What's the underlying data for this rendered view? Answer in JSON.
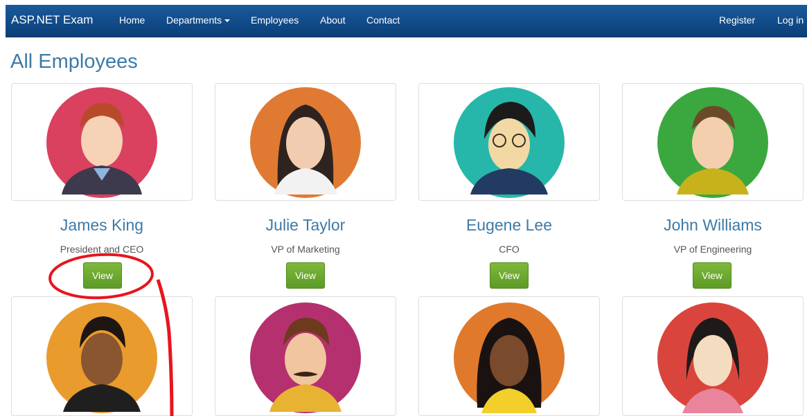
{
  "navbar": {
    "brand": "ASP.NET Exam",
    "links": [
      {
        "label": "Home"
      },
      {
        "label": "Departments"
      },
      {
        "label": "Employees"
      },
      {
        "label": "About"
      },
      {
        "label": "Contact"
      }
    ],
    "right_links": [
      {
        "label": "Register"
      },
      {
        "label": "Log in"
      }
    ]
  },
  "page": {
    "title": "All Employees"
  },
  "employees": [
    {
      "name": "James King",
      "title": "President and CEO",
      "button": "View",
      "avatar_color": "#d9415f"
    },
    {
      "name": "Julie Taylor",
      "title": "VP of Marketing",
      "button": "View",
      "avatar_color": "#e07a32"
    },
    {
      "name": "Eugene Lee",
      "title": "CFO",
      "button": "View",
      "avatar_color": "#27b7aa"
    },
    {
      "name": "John Williams",
      "title": "VP of Engineering",
      "button": "View",
      "avatar_color": "#3aa83e"
    },
    {
      "avatar_color": "#e99b2d"
    },
    {
      "avatar_color": "#b5306e"
    },
    {
      "avatar_color": "#e0792c"
    },
    {
      "avatar_color": "#d9453d"
    }
  ],
  "colors": {
    "navbar": "#0f4a87",
    "heading": "#3d7aa7",
    "button": "#6aa82e",
    "annotation": "#e8141e"
  }
}
